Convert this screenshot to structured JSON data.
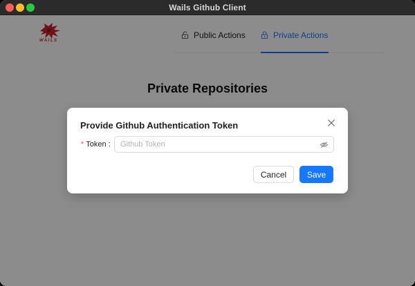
{
  "window": {
    "title": "Wails Github Client"
  },
  "brand": {
    "logo_text": "WAILS"
  },
  "nav": {
    "tabs": [
      {
        "label": "Public Actions",
        "icon": "unlock-icon",
        "active": false
      },
      {
        "label": "Private Actions",
        "icon": "lock-icon",
        "active": true
      }
    ]
  },
  "main": {
    "title": "Private Repositories"
  },
  "modal": {
    "title": "Provide Github Authentication Token",
    "field": {
      "required_mark": "*",
      "label": "Token",
      "colon": ":",
      "placeholder": "Github Token",
      "value": ""
    },
    "cancel_label": "Cancel",
    "save_label": "Save"
  },
  "colors": {
    "accent": "#1677ff",
    "logo": "#c8242b",
    "required": "#ff4d4f"
  }
}
